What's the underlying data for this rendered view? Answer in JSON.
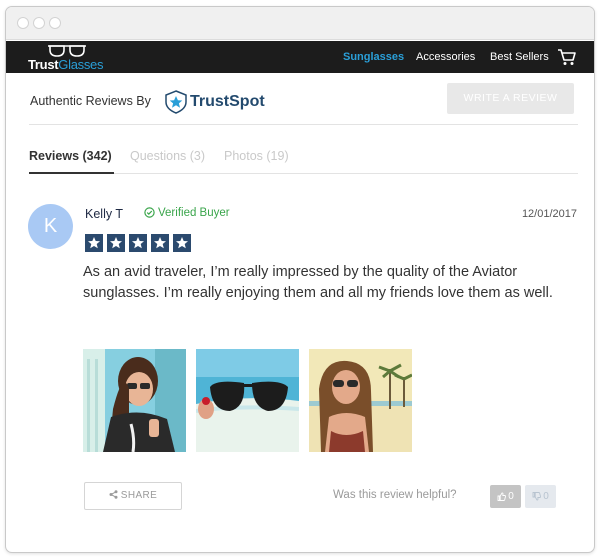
{
  "nav": {
    "brand_part1": "Trust",
    "brand_part2": "Glasses",
    "links": [
      "Sunglasses",
      "Accessories",
      "Best Sellers"
    ],
    "active_link": "Sunglasses"
  },
  "reviews_header": {
    "label": "Authentic Reviews By",
    "provider": "TrustSpot",
    "write_button": "WRITE A REVIEW"
  },
  "tabs": [
    {
      "label": "Reviews (342)",
      "active": true
    },
    {
      "label": "Questions (3)",
      "active": false
    },
    {
      "label": "Photos (19)",
      "active": false
    }
  ],
  "review": {
    "avatar_initial": "K",
    "author": "Kelly T",
    "verified_label": "Verified Buyer",
    "date": "12/01/2017",
    "rating": 5,
    "rating_max": 5,
    "text": "As an avid traveler, I’m really impressed by the quality of the Aviator sunglasses. I’m really enjoying them and all my friends love them as well.",
    "photos": [
      "woman-with-aviators-photo",
      "sunglasses-on-beach-photo",
      "woman-at-beach-photo"
    ],
    "share_label": "SHARE",
    "helpful_question": "Was this review helpful?",
    "helpful_yes": "0",
    "helpful_no": "0"
  },
  "colors": {
    "navbar": "#1c1c1c",
    "accent": "#2a9fd8",
    "verified": "#3aa54b",
    "star_bg": "#2b4a6e",
    "avatar": "#a9c9f4"
  }
}
